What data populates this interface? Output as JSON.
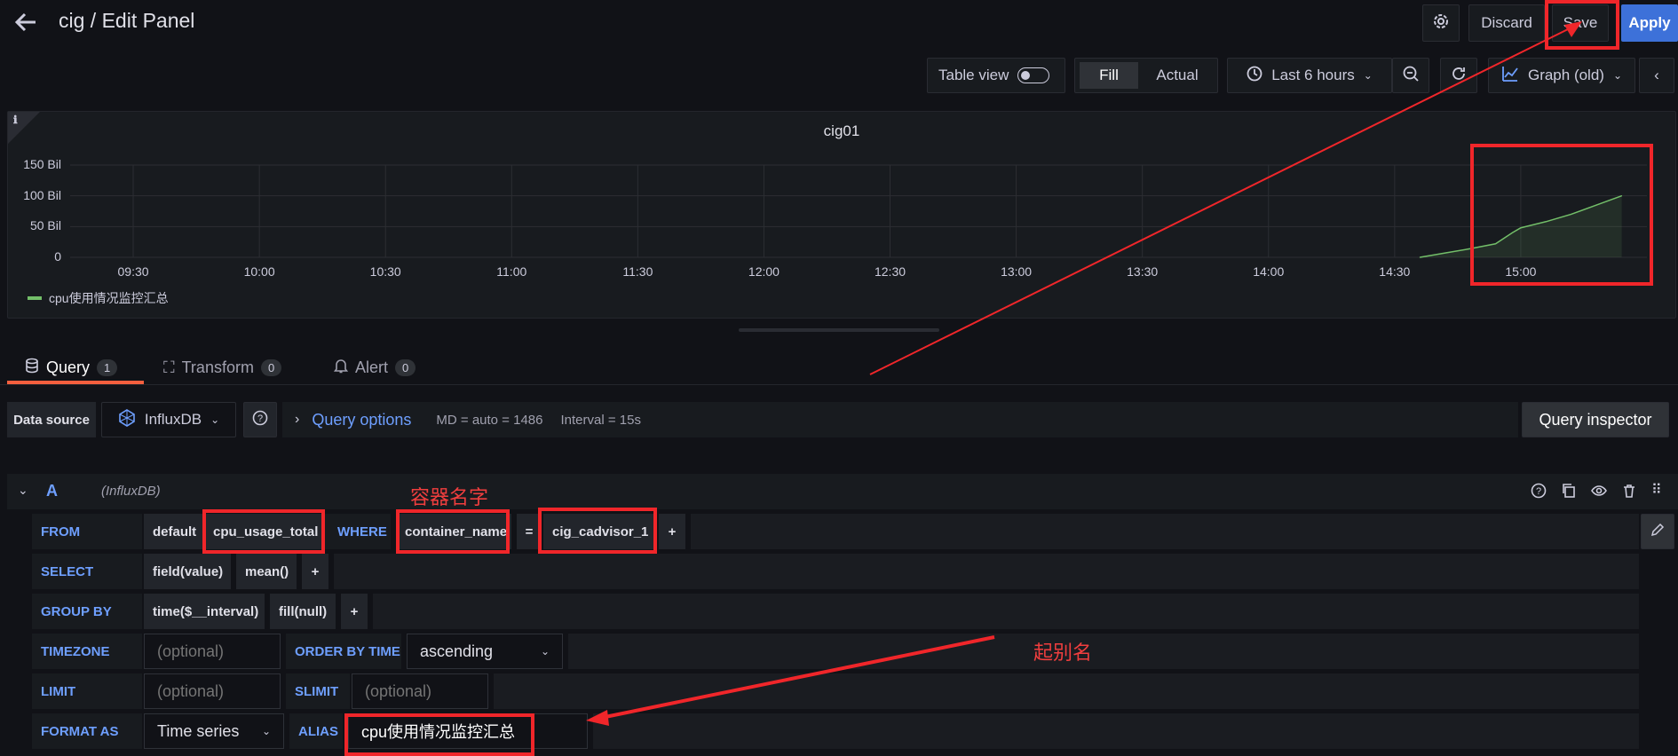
{
  "header": {
    "title": "cig / Edit Panel",
    "discard_label": "Discard",
    "save_label": "Save",
    "apply_label": "Apply"
  },
  "toolbar": {
    "table_view_label": "Table view",
    "fill_label": "Fill",
    "actual_label": "Actual",
    "time_range_label": "Last 6 hours",
    "viz_label": "Graph (old)"
  },
  "panel": {
    "title": "cig01",
    "legend_label": "cpu使用情况监控汇总",
    "legend_color": "#73bf69",
    "chart_data": {
      "type": "area",
      "y_ticks": [
        "150 Bil",
        "100 Bil",
        "50 Bil",
        "0"
      ],
      "x_ticks": [
        "09:30",
        "10:00",
        "10:30",
        "11:00",
        "11:30",
        "12:00",
        "12:30",
        "13:00",
        "13:30",
        "14:00",
        "14:30",
        "15:00"
      ],
      "series": [
        {
          "name": "cpu使用情况监控汇总",
          "x": [
            "14:36",
            "14:42",
            "14:48",
            "14:54",
            "14:58",
            "15:00",
            "15:06",
            "15:12",
            "15:18",
            "15:24"
          ],
          "values": [
            0,
            7,
            14,
            22,
            40,
            48,
            58,
            70,
            85,
            100
          ],
          "unit": "Bil"
        }
      ],
      "ylim": [
        0,
        150
      ]
    }
  },
  "tabs": {
    "query_label": "Query",
    "query_count": "1",
    "transform_label": "Transform",
    "transform_count": "0",
    "alert_label": "Alert",
    "alert_count": "0"
  },
  "datasource": {
    "label": "Data source",
    "name": "InfluxDB",
    "query_options_label": "Query options",
    "md_text": "MD = auto = 1486",
    "interval_text": "Interval = 15s",
    "inspector_label": "Query inspector"
  },
  "query": {
    "ref_id": "A",
    "source_hint": "(InfluxDB)",
    "from_label": "FROM",
    "from_policy": "default",
    "from_measurement": "cpu_usage_total",
    "where_label": "WHERE",
    "where_key": "container_name",
    "where_op": "=",
    "where_value": "cig_cadvisor_1",
    "plus": "+",
    "select_label": "SELECT",
    "select_field": "field(value)",
    "select_fn": "mean()",
    "groupby_label": "GROUP BY",
    "groupby_time": "time($__interval)",
    "groupby_fill": "fill(null)",
    "timezone_label": "TIMEZONE",
    "timezone_placeholder": "(optional)",
    "orderby_label": "ORDER BY TIME",
    "orderby_value": "ascending",
    "limit_label": "LIMIT",
    "limit_placeholder": "(optional)",
    "slimit_label": "SLIMIT",
    "slimit_placeholder": "(optional)",
    "format_label": "FORMAT AS",
    "format_value": "Time series",
    "alias_label": "ALIAS",
    "alias_value": "cpu使用情况监控汇总"
  },
  "annotations": {
    "container_name_note": "容器名字",
    "alias_note": "起别名"
  }
}
